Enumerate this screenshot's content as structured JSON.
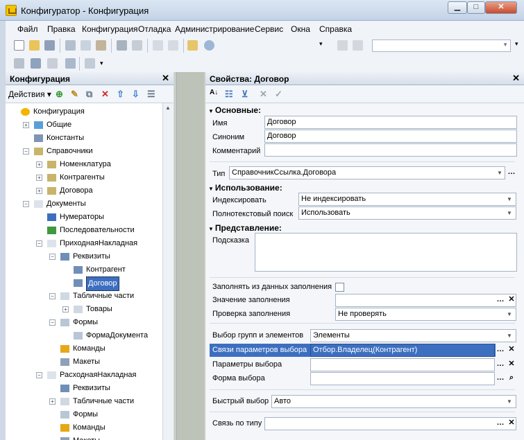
{
  "window": {
    "title": "Конфигуратор - Конфигурация",
    "minimize": "▁",
    "maximize": "□",
    "close": "✕"
  },
  "menu": [
    "Файл",
    "Правка",
    "Конфигурация",
    "Отладка",
    "Администрирование",
    "Сервис",
    "Окна",
    "Справка"
  ],
  "left_panel": {
    "title": "Конфигурация",
    "actions_label": "Действия ▾",
    "tree": [
      {
        "label": "Конфигурация",
        "level": 0,
        "toggle": "",
        "icon": "config-icon"
      },
      {
        "label": "Общие",
        "level": 1,
        "toggle": "+",
        "icon": "common-icon"
      },
      {
        "label": "Константы",
        "level": 1,
        "toggle": "",
        "icon": "constants-icon"
      },
      {
        "label": "Справочники",
        "level": 1,
        "toggle": "−",
        "icon": "catalog-icon"
      },
      {
        "label": "Номенклатура",
        "level": 2,
        "toggle": "+",
        "icon": "catalog-icon"
      },
      {
        "label": "Контрагенты",
        "level": 2,
        "toggle": "+",
        "icon": "catalog-icon"
      },
      {
        "label": "Договора",
        "level": 2,
        "toggle": "+",
        "icon": "catalog-icon"
      },
      {
        "label": "Документы",
        "level": 1,
        "toggle": "−",
        "icon": "document-icon"
      },
      {
        "label": "Нумераторы",
        "level": 2,
        "toggle": "",
        "icon": "numerator-icon"
      },
      {
        "label": "Последовательности",
        "level": 2,
        "toggle": "",
        "icon": "sequence-icon"
      },
      {
        "label": "ПриходнаяНакладная",
        "level": 2,
        "toggle": "−",
        "icon": "document-icon"
      },
      {
        "label": "Реквизиты",
        "level": 3,
        "toggle": "−",
        "icon": "attribute-icon"
      },
      {
        "label": "Контрагент",
        "level": 4,
        "toggle": "",
        "icon": "attribute-icon"
      },
      {
        "label": "Договор",
        "level": 4,
        "toggle": "",
        "icon": "attribute-icon",
        "selected": true
      },
      {
        "label": "Табличные части",
        "level": 3,
        "toggle": "−",
        "icon": "table-icon"
      },
      {
        "label": "Товары",
        "level": 4,
        "toggle": "+",
        "icon": "table-icon"
      },
      {
        "label": "Формы",
        "level": 3,
        "toggle": "−",
        "icon": "form-icon"
      },
      {
        "label": "ФормаДокумента",
        "level": 4,
        "toggle": "",
        "icon": "form-icon"
      },
      {
        "label": "Команды",
        "level": 3,
        "toggle": "",
        "icon": "command-icon"
      },
      {
        "label": "Макеты",
        "level": 3,
        "toggle": "",
        "icon": "template-icon"
      },
      {
        "label": "РасходнаяНакладная",
        "level": 2,
        "toggle": "−",
        "icon": "document-icon"
      },
      {
        "label": "Реквизиты",
        "level": 3,
        "toggle": "",
        "icon": "attribute-icon"
      },
      {
        "label": "Табличные части",
        "level": 3,
        "toggle": "+",
        "icon": "table-icon"
      },
      {
        "label": "Формы",
        "level": 3,
        "toggle": "",
        "icon": "form-icon"
      },
      {
        "label": "Команды",
        "level": 3,
        "toggle": "",
        "icon": "command-icon"
      },
      {
        "label": "Макеты",
        "level": 3,
        "toggle": "",
        "icon": "template-icon"
      }
    ]
  },
  "props": {
    "title": "Свойства: Договор",
    "sec_basic": "Основные:",
    "name_l": "Имя",
    "name_v": "Договор",
    "syn_l": "Синоним",
    "syn_v": "Договор",
    "comment_l": "Комментарий",
    "comment_v": "",
    "type_l": "Тип",
    "type_v": "СправочникСсылка.Договора",
    "sec_use": "Использование:",
    "idx_l": "Индексировать",
    "idx_v": "Не индексировать",
    "fts_l": "Полнотекстовый поиск",
    "fts_v": "Использовать",
    "sec_view": "Представление:",
    "hint_l": "Подсказка",
    "hint_v": "",
    "fill_l": "Заполнять из данных заполнения",
    "fillval_l": "Значение заполнения",
    "fillval_v": "",
    "check_l": "Проверка заполнения",
    "check_v": "Не проверять",
    "grp_l": "Выбор групп и элементов",
    "grp_v": "Элементы",
    "link_l": "Связи параметров выбора",
    "link_v": "Отбор.Владелец(Контрагент)",
    "par_l": "Параметры выбора",
    "par_v": "",
    "form_l": "Форма выбора",
    "form_v": "",
    "quick_l": "Быстрый выбор",
    "quick_v": "Авто",
    "typelink_l": "Связь по типу",
    "typelink_v": ""
  }
}
